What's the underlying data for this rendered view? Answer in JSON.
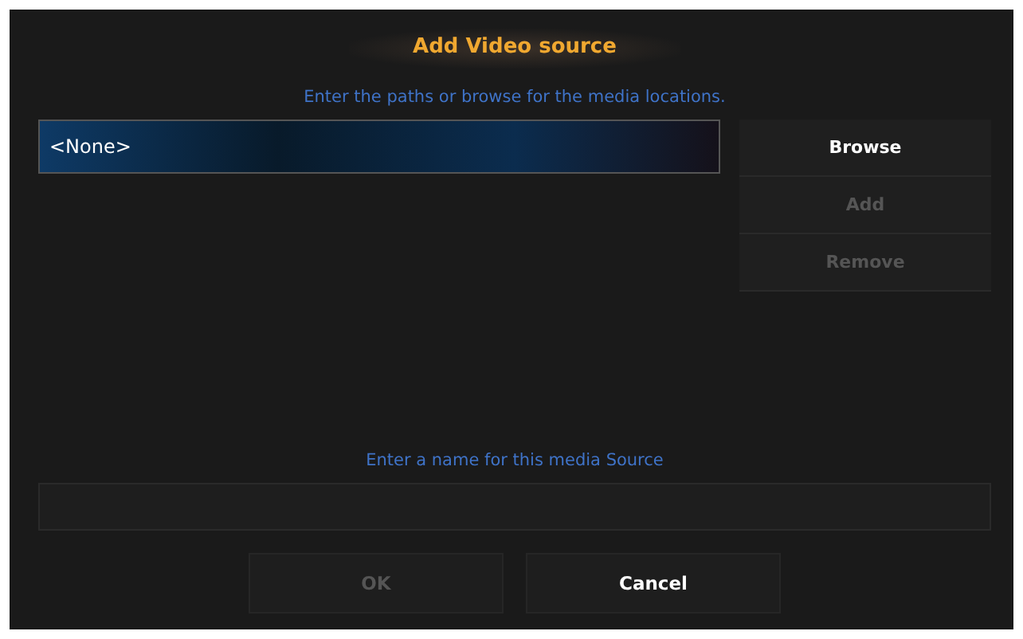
{
  "dialog": {
    "title": "Add Video source"
  },
  "paths": {
    "instruction": "Enter the paths or browse for the media locations.",
    "items": [
      {
        "label": "<None>",
        "selected": true
      }
    ]
  },
  "side_buttons": [
    {
      "label": "Browse",
      "disabled": false
    },
    {
      "label": "Add",
      "disabled": true
    },
    {
      "label": "Remove",
      "disabled": true
    }
  ],
  "name": {
    "label": "Enter a name for this media Source"
  },
  "buttons": [
    {
      "label": "OK",
      "disabled": true
    },
    {
      "label": "Cancel",
      "disabled": false
    }
  ]
}
